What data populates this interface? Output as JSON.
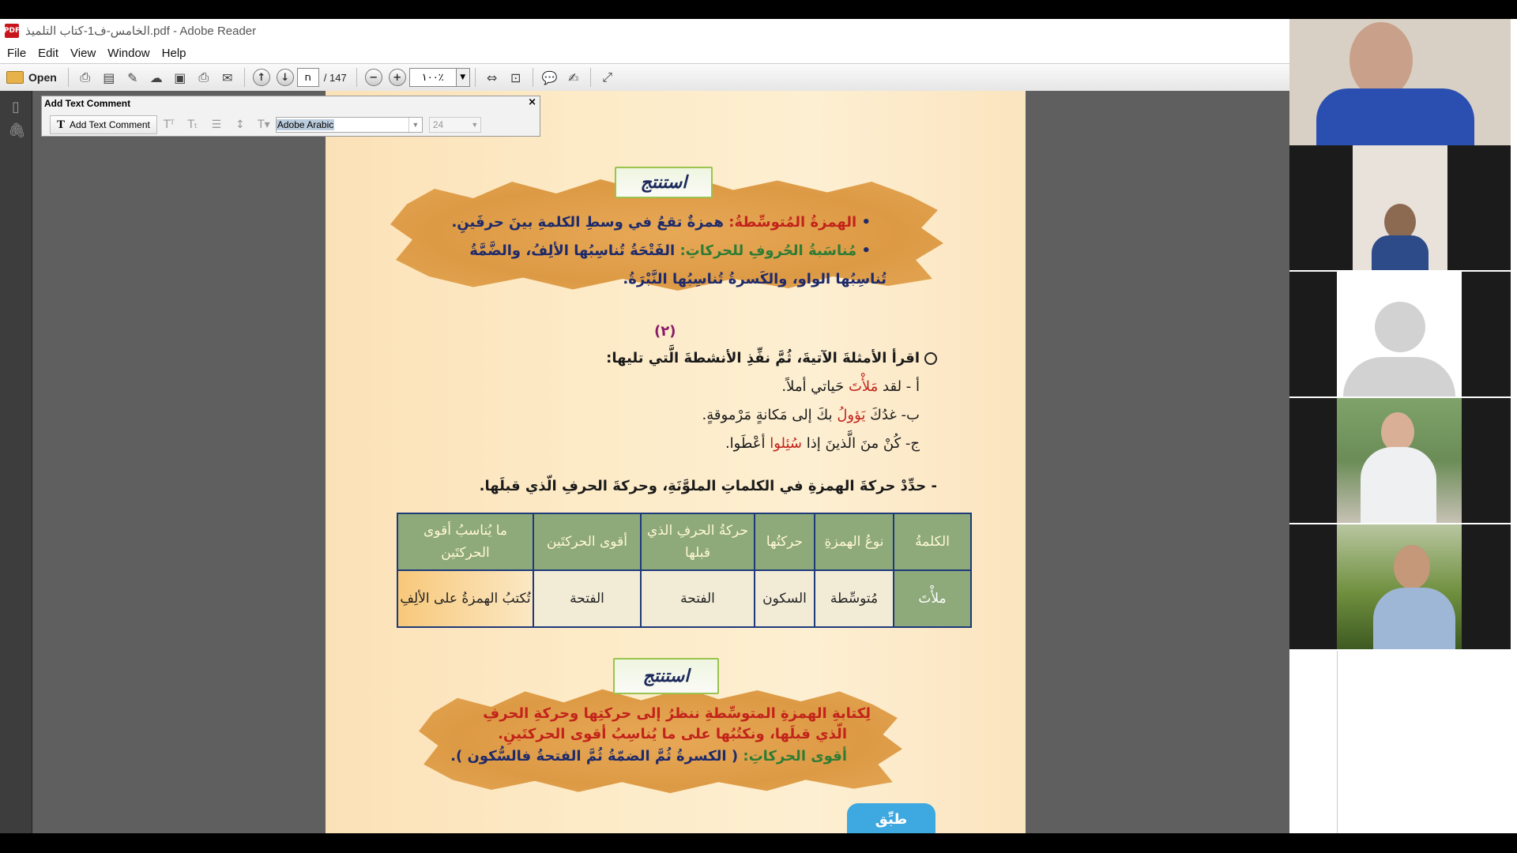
{
  "window": {
    "title": "الخامس-ف1-كتاب التلميذ.pdf - Adobe Reader",
    "icon_label": "PDF"
  },
  "menu": [
    "File",
    "Edit",
    "View",
    "Window",
    "Help"
  ],
  "toolbar": {
    "open_label": "Open",
    "page_current": "ח",
    "page_total": "/ 147",
    "zoom_value": "١٠٠٪"
  },
  "comment_toolbar": {
    "title": "Add Text Comment",
    "close": "×",
    "add_button": "Add Text Comment",
    "font_value": "Adobe Arabic",
    "size_value": "24"
  },
  "page": {
    "conclude_label_1": "استنتج",
    "box1": {
      "line1_term": "الهمزةُ المُتوسِّطةُ:",
      "line1_def": "همزةٌ تقعُ في وسطِ الكلمةِ بينَ حرفَينِ.",
      "line2_term": "مُناسَبةُ الحُروفِ للحركاتِ:",
      "line2_def": "الفَتْحَةُ تُناسِبُها الألِفُ، والضَّمَّةُ",
      "line3": "تُناسِبُها الواو، والكَسرةُ تُناسِبُها النَّبْرَةُ."
    },
    "section_number": "(٢)",
    "instruction": "اقرأ الأمثلةَ الآتيةَ، ثُمَّ نفِّذِ الأنشطةَ الَّتي تليها:",
    "examples": [
      {
        "prefix": "أ  - لقد ",
        "highlight": "مَلأْتَ",
        "suffix": " حَياتي أملاً."
      },
      {
        "prefix": "ب- غدُكَ ",
        "highlight": "يَؤولُ",
        "suffix": " بكَ إلى مَكانةٍ مَرْموقةٍ."
      },
      {
        "prefix": "ج- كُنْ منَ الَّذينَ إذا ",
        "highlight": "سُئِلوا",
        "suffix": " أعْطَوا."
      }
    ],
    "task": "- حدِّدْ حركةَ الهمزةِ في الكلماتِ الملوَّنَةِ، وحركةَ الحرفِ الّذي قبلَها.",
    "table": {
      "headers": [
        "الكلمةُ",
        "نوعُ الهمزةِ",
        "حركتُها",
        "حركةُ الحرفِ الذي قبلها",
        "أقوى الحركتَين",
        "ما يُناسبُ أقوى الحركتَين"
      ],
      "row": [
        "ملأْتَ",
        "مُتوسِّطة",
        "السكون",
        "الفتحة",
        "الفتحة",
        "تُكتبُ الهمزةُ على الألِفِ"
      ]
    },
    "conclude_label_2": "استنتج",
    "box2": {
      "line1": "لِكتابةِ الهمزةِ المتوسِّطةِ ننظرُ إلى حركتِها وحركةِ الحرفِ",
      "line2": "الّذي قبلَها، ونكتُبُها على ما يُناسِبُ أقوى الحركتَينِ.",
      "line3_term": "أقوى الحركاتِ:",
      "line3_def": "( الكسرةُ ثُمَّ الضمّةُ ثُمَّ الفتحةُ فالسُّكون )."
    },
    "practice_label": "طبِّق"
  },
  "colors": {
    "accent_red": "#c2231b",
    "navy": "#1e2a6a",
    "green": "#2e7c34",
    "table_header": "#8ea97a",
    "practice_blue": "#3ea8e0"
  }
}
